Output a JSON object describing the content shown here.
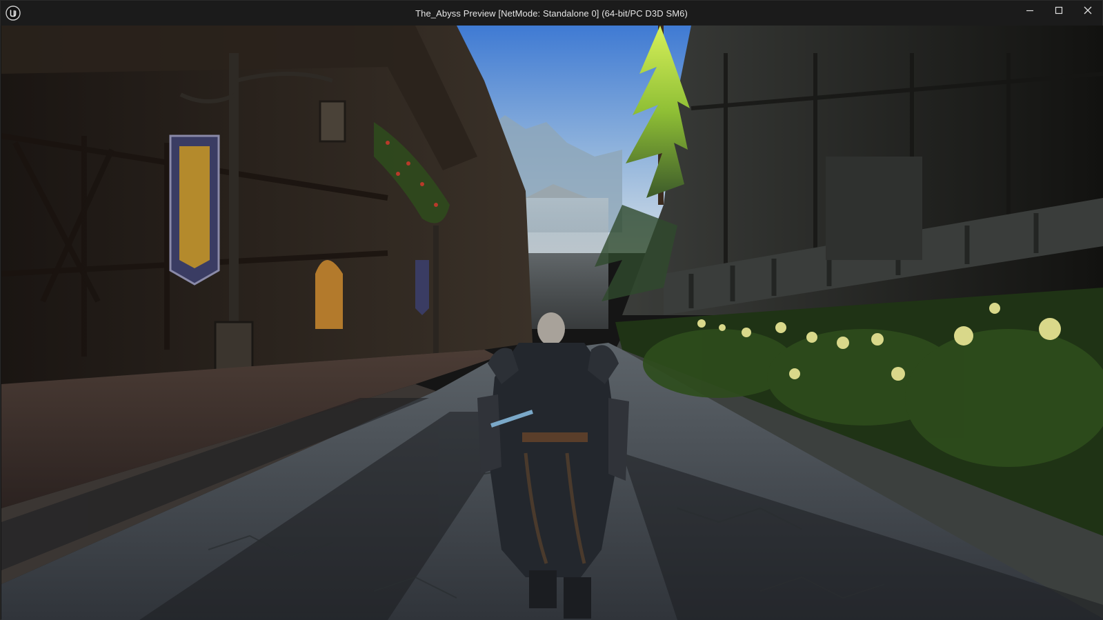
{
  "window": {
    "title": "The_Abyss Preview [NetMode: Standalone 0]  (64-bit/PC D3D SM6)",
    "app_icon": "unreal-engine-logo-icon",
    "controls": {
      "minimize_icon": "minimize-icon",
      "maximize_icon": "maximize-icon",
      "close_icon": "close-icon"
    }
  },
  "viewport": {
    "scene": "game-viewport",
    "colors": {
      "sky_top": "#4f86d6",
      "sky_bottom": "#c9d9e6",
      "road": "#3f4347",
      "foliage": "#2f4a1d",
      "tree_highlight": "#c8e84a"
    }
  }
}
